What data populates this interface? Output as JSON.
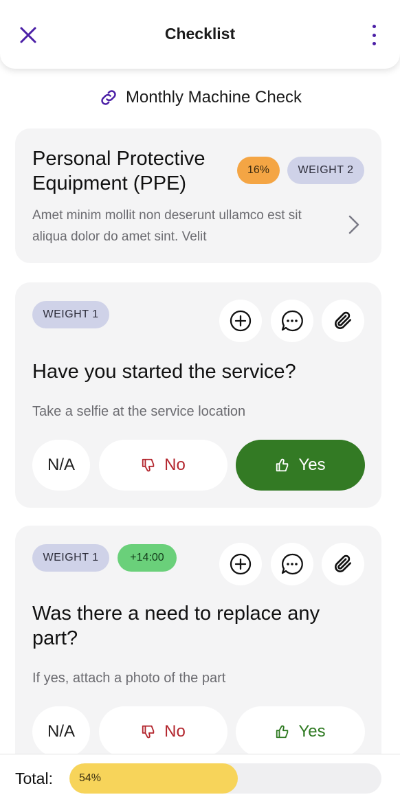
{
  "header": {
    "title": "Checklist",
    "close_icon": "close-icon",
    "more_icon": "more-vertical-icon",
    "accent_color": "#4b1fa6"
  },
  "checklist": {
    "name": "Monthly Machine Check",
    "icon": "link-icon"
  },
  "section": {
    "title": "Personal Protective Equipment (PPE)",
    "percent": "16%",
    "weight": "WEIGHT 2",
    "description": "Amet minim mollit non deserunt ullamco est sit aliqua dolor do amet sint. Velit",
    "chevron": "chevron-right-icon"
  },
  "questions": [
    {
      "weight": "WEIGHT 1",
      "title": "Have you started the service?",
      "hint": "Take a selfie at the service location",
      "options": {
        "na": "N/A",
        "no": "No",
        "yes": "Yes"
      },
      "selected": "yes"
    },
    {
      "weight": "WEIGHT 1",
      "time": "+14:00",
      "title": "Was there a need to replace any part?",
      "hint": "If yes, attach a photo of the part",
      "options": {
        "na": "N/A",
        "no": "No",
        "yes": "Yes"
      },
      "selected": null
    }
  ],
  "footer": {
    "total_label": "Total:",
    "percent_label": "54%",
    "progress": 0.54,
    "bar_color": "#f7d45a"
  },
  "colors": {
    "yes_selected": "#337a24",
    "no_text": "#b3262e",
    "weight_badge": "#cfd2e8",
    "percent_badge": "#f4a544",
    "time_badge": "#6ad07a"
  }
}
